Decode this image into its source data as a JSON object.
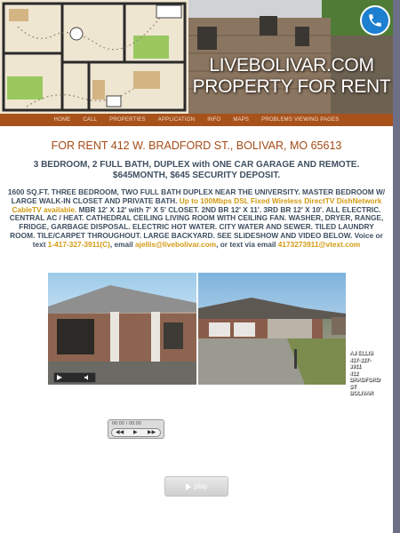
{
  "site": {
    "title": "LIVEBOLIVAR.COM",
    "subtitle": "PROPERTY FOR RENT"
  },
  "nav": {
    "items": [
      "HOME",
      "CALL",
      "PROPERTIES",
      "APPLICATION",
      "INFO",
      "MAPS",
      "PROBLEMS VIEWING PAGES"
    ]
  },
  "listing": {
    "headline": "FOR RENT 412 W. BRADFORD ST., BOLIVAR, MO 65613",
    "subhead": "3 BEDROOM, 2 FULL BATH, DUPLEX with ONE CAR GARAGE AND REMOTE. $645MONTH, $645 SECURITY DEPOSIT.",
    "desc_part1": "1600 SQ.FT. THREE BEDROOM, TWO FULL BATH DUPLEX NEAR THE UNIVERSITY.  MASTER BEDROOM W/ LARGE WALK-IN CLOSET AND PRIVATE BATH.  ",
    "desc_highlight": "Up to 100Mbps DSL Fixed Wireless DirectTV DishNetwork CableTV available.",
    "desc_part2": "  MBR 12' X 12' with 7' X 5' CLOSET.  2ND BR 12' X 11'.  3RD BR 12' X 10'.  ALL ELECTRIC.  CENTRAL AC / HEAT.  CATHEDRAL CEILING LIVING ROOM WITH CEILING FAN.   WASHER, DRYER, RANGE, FRIDGE, GARBAGE DISPOSAL. ELECTRIC HOT WATER.  CITY WATER AND SEWER.  TILED LAUNDRY ROOM.  TILE/CARPET THROUGHOUT.  LARGE BACKYARD.  SEE SLIDESHOW AND VIDEO BELOW.  Voice or text ",
    "phone": "1-417-327-3911(C)",
    "email_prefix": ", email ",
    "email": "ajellis@livebolivar.com",
    "text_prefix": ", or text via email ",
    "text_email": "4173273911@vtext.com"
  },
  "slideshow": {
    "caption_line1": "AJ ELLIS",
    "caption_line2": "417-327-3911",
    "caption_line3": "412 BRADFORD ST BOLIVAR"
  },
  "mini_player": {
    "label": "00:00 / 00:00",
    "prev": "◀◀",
    "play": "▶",
    "next": "▶▶"
  },
  "play_button": {
    "label": "play"
  },
  "colors": {
    "nav_bg": "#a8521b",
    "headline": "#a44b17",
    "body_text": "#3f4f61",
    "highlight": "#d39a12",
    "phone_button": "#1c7fd0"
  }
}
